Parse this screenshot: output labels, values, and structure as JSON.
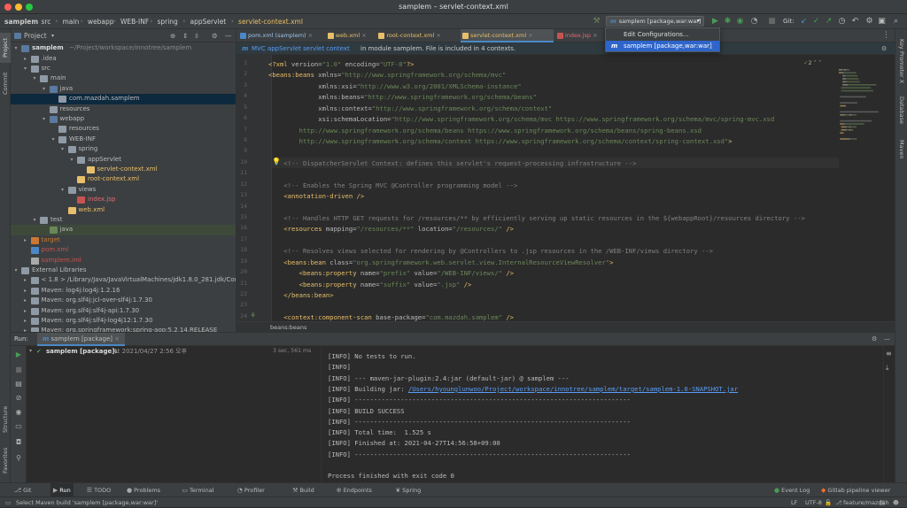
{
  "window": {
    "title": "samplem – servlet-context.xml"
  },
  "breadcrumbs": [
    "samplem",
    "src",
    "main",
    "webapp",
    "WEB-INF",
    "spring",
    "appServlet",
    "servlet-context.xml"
  ],
  "toolbar": {
    "run_config": "samplem [package,war:war]",
    "git_label": "Git:"
  },
  "dropdown": {
    "items": [
      "Edit Configurations...",
      "samplem [package,war:war]"
    ],
    "selected_index": 1
  },
  "left_tool_tabs": [
    "Project",
    "Commit",
    "Structure",
    "Favorites"
  ],
  "right_tool_tabs": [
    "Key Promoter X",
    "Database",
    "Maven"
  ],
  "project": {
    "title": "Project",
    "root_name": "samplem",
    "root_path": "~/Project/workspace/innotree/samplem",
    "tree": [
      {
        "label": ".idea",
        "indent": 1,
        "arrow": "▸",
        "type": "folder"
      },
      {
        "label": "src",
        "indent": 1,
        "arrow": "▾",
        "type": "folder"
      },
      {
        "label": "main",
        "indent": 2,
        "arrow": "▾",
        "type": "folder"
      },
      {
        "label": "java",
        "indent": 3,
        "arrow": "▾",
        "type": "srcfolder"
      },
      {
        "label": "com.mazdah.samplem",
        "indent": 4,
        "arrow": "",
        "type": "package",
        "selected": true
      },
      {
        "label": "resources",
        "indent": 3,
        "arrow": "",
        "type": "folder"
      },
      {
        "label": "webapp",
        "indent": 3,
        "arrow": "▾",
        "type": "webfolder"
      },
      {
        "label": "resources",
        "indent": 4,
        "arrow": "",
        "type": "folder"
      },
      {
        "label": "WEB-INF",
        "indent": 4,
        "arrow": "▾",
        "type": "folder"
      },
      {
        "label": "spring",
        "indent": 5,
        "arrow": "▾",
        "type": "folder"
      },
      {
        "label": "appServlet",
        "indent": 6,
        "arrow": "▾",
        "type": "folder"
      },
      {
        "label": "servlet-context.xml",
        "indent": 7,
        "arrow": "",
        "type": "xml"
      },
      {
        "label": "root-context.xml",
        "indent": 6,
        "arrow": "",
        "type": "xml"
      },
      {
        "label": "views",
        "indent": 5,
        "arrow": "▾",
        "type": "folder"
      },
      {
        "label": "index.jsp",
        "indent": 6,
        "arrow": "",
        "type": "jsp"
      },
      {
        "label": "web.xml",
        "indent": 5,
        "arrow": "",
        "type": "xml"
      },
      {
        "label": "test",
        "indent": 2,
        "arrow": "▾",
        "type": "folder"
      },
      {
        "label": "java",
        "indent": 3,
        "arrow": "",
        "type": "testfolder",
        "highlight": true
      },
      {
        "label": "target",
        "indent": 1,
        "arrow": "▸",
        "type": "excluded"
      },
      {
        "label": "pom.xml",
        "indent": 1,
        "arrow": "",
        "type": "maven"
      },
      {
        "label": "samplem.iml",
        "indent": 1,
        "arrow": "",
        "type": "iml"
      },
      {
        "label": "External Libraries",
        "indent": 0,
        "arrow": "▾",
        "type": "lib"
      },
      {
        "label": "< 1.8 > /Library/Java/JavaVirtualMachines/jdk1.8.0_281.jdk/Cont",
        "indent": 1,
        "arrow": "▸",
        "type": "jdk"
      },
      {
        "label": "Maven: log4j:log4j:1.2.16",
        "indent": 1,
        "arrow": "▸",
        "type": "jar"
      },
      {
        "label": "Maven: org.slf4j:jcl-over-slf4j:1.7.30",
        "indent": 1,
        "arrow": "▸",
        "type": "jar"
      },
      {
        "label": "Maven: org.slf4j:slf4j-api:1.7.30",
        "indent": 1,
        "arrow": "▸",
        "type": "jar"
      },
      {
        "label": "Maven: org.slf4j:slf4j-log4j12:1.7.30",
        "indent": 1,
        "arrow": "▸",
        "type": "jar"
      },
      {
        "label": "Maven: org.springframework:spring-aop:5.2.14.RELEASE",
        "indent": 1,
        "arrow": "▸",
        "type": "jar"
      }
    ]
  },
  "editor_tabs": [
    {
      "label": "pom.xml (samplem)",
      "color": "#4a88c7"
    },
    {
      "label": "web.xml",
      "color": "#e8bf6a"
    },
    {
      "label": "root-context.xml",
      "color": "#e8bf6a"
    },
    {
      "label": "servlet-context.xml",
      "color": "#e8bf6a",
      "active": true
    },
    {
      "label": "index.jsp",
      "color": "#c75450"
    }
  ],
  "banner": {
    "context": "MVC appServlet servlet context",
    "message": "in module samplem. File is included in 4 contexts."
  },
  "inspection": {
    "count": "2"
  },
  "code_lines": [
    {
      "n": "1",
      "parts": [
        [
          "tg",
          "<?xml "
        ],
        [
          "at",
          "version="
        ],
        [
          "av",
          "\"1.0\" "
        ],
        [
          "at",
          "encoding="
        ],
        [
          "av",
          "\"UTF-8\""
        ],
        [
          "tg",
          "?>"
        ]
      ]
    },
    {
      "n": "2",
      "parts": [
        [
          "tg",
          "<beans:beans "
        ],
        [
          "at",
          "xmlns="
        ],
        [
          "av",
          "\"http://www.springframework.org/schema/mvc\""
        ]
      ]
    },
    {
      "n": "3",
      "parts": [
        [
          "at",
          "             xmlns:xsi="
        ],
        [
          "av",
          "\"http://www.w3.org/2001/XMLSchema-instance\""
        ]
      ]
    },
    {
      "n": "4",
      "parts": [
        [
          "at",
          "             xmlns:beans="
        ],
        [
          "av",
          "\"http://www.springframework.org/schema/beans\""
        ]
      ]
    },
    {
      "n": "5",
      "parts": [
        [
          "at",
          "             xmlns:context="
        ],
        [
          "av",
          "\"http://www.springframework.org/schema/context\""
        ]
      ]
    },
    {
      "n": "6",
      "parts": [
        [
          "at",
          "             xsi:schemaLocation="
        ],
        [
          "av",
          "\"http://www.springframework.org/schema/mvc https://www.springframework.org/schema/mvc/spring-mvc.xsd"
        ]
      ]
    },
    {
      "n": "7",
      "parts": [
        [
          "av",
          "        http://www.springframework.org/schema/beans https://www.springframework.org/schema/beans/spring-beans.xsd"
        ]
      ]
    },
    {
      "n": "8",
      "parts": [
        [
          "av",
          "        http://www.springframework.org/schema/context https://www.springframework.org/schema/context/spring-context.xsd\""
        ],
        [
          "tg",
          ">"
        ]
      ]
    },
    {
      "n": "9",
      "parts": []
    },
    {
      "n": "10",
      "parts": [
        [
          "cm",
          "    <!-- DispatcherServlet Context: defines this servlet's request-processing infrastructure -->"
        ]
      ],
      "current": true
    },
    {
      "n": "11",
      "parts": []
    },
    {
      "n": "12",
      "parts": [
        [
          "cm",
          "    <!-- Enables the Spring MVC @Controller programming model -->"
        ]
      ]
    },
    {
      "n": "13",
      "parts": [
        [
          "tg",
          "    <annotation-driven />"
        ]
      ]
    },
    {
      "n": "14",
      "parts": []
    },
    {
      "n": "15",
      "parts": [
        [
          "cm",
          "    <!-- Handles HTTP GET requests for /resources/** by efficiently serving up static resources in the ${webappRoot}/resources directory -->"
        ]
      ]
    },
    {
      "n": "16",
      "parts": [
        [
          "tg",
          "    <resources "
        ],
        [
          "at",
          "mapping="
        ],
        [
          "av",
          "\"/resources/**\" "
        ],
        [
          "at",
          "location="
        ],
        [
          "av",
          "\"/resources/\" "
        ],
        [
          "tg",
          "/>"
        ]
      ]
    },
    {
      "n": "17",
      "parts": []
    },
    {
      "n": "18",
      "parts": [
        [
          "cm",
          "    <!-- Resolves views selected for rendering by @Controllers to .jsp resources in the /WEB-INF/views directory -->"
        ]
      ]
    },
    {
      "n": "19",
      "parts": [
        [
          "tg",
          "    <beans:bean "
        ],
        [
          "at",
          "class="
        ],
        [
          "av",
          "\"org.springframework.web.servlet.view.InternalResourceViewResolver\""
        ],
        [
          "tg",
          ">"
        ]
      ]
    },
    {
      "n": "20",
      "parts": [
        [
          "tg",
          "        <beans:property "
        ],
        [
          "at",
          "name="
        ],
        [
          "av",
          "\"prefix\" "
        ],
        [
          "at",
          "value="
        ],
        [
          "av",
          "\"/WEB-INF/views/\" "
        ],
        [
          "tg",
          "/>"
        ]
      ]
    },
    {
      "n": "21",
      "parts": [
        [
          "tg",
          "        <beans:property "
        ],
        [
          "at",
          "name="
        ],
        [
          "av",
          "\"suffix\" "
        ],
        [
          "at",
          "value="
        ],
        [
          "av",
          "\".jsp\" "
        ],
        [
          "tg",
          "/>"
        ]
      ]
    },
    {
      "n": "22",
      "parts": [
        [
          "tg",
          "    </beans:bean>"
        ]
      ]
    },
    {
      "n": "23",
      "parts": []
    },
    {
      "n": "24",
      "parts": [
        [
          "tg",
          "    <context:component-scan "
        ],
        [
          "at",
          "base-package="
        ],
        [
          "av",
          "\"com.mazdah.samplem\" "
        ],
        [
          "tg",
          "/>"
        ]
      ]
    }
  ],
  "editor_status": "beans:beans",
  "run": {
    "label": "Run:",
    "tab": "samplem [package]",
    "tree_item": "samplem [package]:",
    "tree_time": "At 2021/04/27 2:56 오후",
    "duration": "3 sec, 561 ms",
    "console": [
      {
        "text": "[INFO] No tests to run."
      },
      {
        "text": "[INFO]"
      },
      {
        "text": "[INFO] --- maven-jar-plugin:2.4:jar (default-jar) @ samplem ---"
      },
      {
        "text": "[INFO] Building jar: ",
        "link": "/Users/hyounglunwoo/Project/workspace/innotree/samplem/target/samplem-1.0-SNAPSHOT.jar"
      },
      {
        "text": "[INFO] ------------------------------------------------------------------------"
      },
      {
        "text": "[INFO] BUILD SUCCESS"
      },
      {
        "text": "[INFO] ------------------------------------------------------------------------"
      },
      {
        "text": "[INFO] Total time:  1.525 s"
      },
      {
        "text": "[INFO] Finished at: 2021-04-27T14:56:58+09:00"
      },
      {
        "text": "[INFO] ------------------------------------------------------------------------"
      },
      {
        "text": ""
      },
      {
        "text": "Process finished with exit code 0"
      }
    ]
  },
  "bottom_tabs": [
    {
      "label": "Git",
      "icon": "⎇"
    },
    {
      "label": "Run",
      "icon": "▶",
      "active": true
    },
    {
      "label": "TODO",
      "icon": "☰"
    },
    {
      "label": "Problems",
      "icon": "●"
    },
    {
      "label": "Terminal",
      "icon": "▭"
    },
    {
      "label": "Profiler",
      "icon": "◔"
    },
    {
      "label": "Build",
      "icon": "⚒"
    },
    {
      "label": "Endpoints",
      "icon": "⊕"
    },
    {
      "label": "Spring",
      "icon": "❦"
    }
  ],
  "bottom_right_tabs": [
    {
      "label": "Event Log",
      "icon": "●"
    },
    {
      "label": "Gitlab pipeline viewer",
      "icon": "◆"
    }
  ],
  "status": {
    "message": "Select Maven build 'samplem [package,war:war]'",
    "line_sep": "LF",
    "encoding": "UTF-8",
    "branch": "feature/mazdah"
  },
  "colors": {
    "accent": "#2f65ca",
    "run_green": "#499c54",
    "link": "#589df6"
  }
}
